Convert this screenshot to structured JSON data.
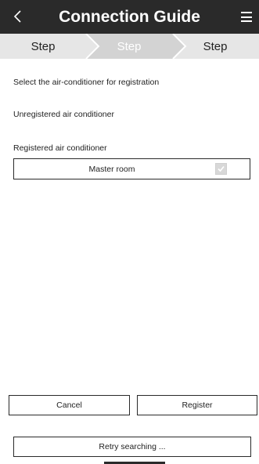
{
  "header": {
    "title": "Connection Guide",
    "back_icon": "chevron-left-icon",
    "menu_icon": "hamburger-menu-icon"
  },
  "steps": [
    {
      "label": "Step",
      "active": false
    },
    {
      "label": "Step",
      "active": true
    },
    {
      "label": "Step",
      "active": false
    }
  ],
  "content": {
    "instruction": "Select the air-conditioner for registration",
    "unregistered_label": "Unregistered air conditioner",
    "registered_label": "Registered air conditioner",
    "registered_items": [
      {
        "name": "Master room",
        "checked": true
      }
    ]
  },
  "buttons": {
    "cancel": "Cancel",
    "register": "Register",
    "retry": "Retry searching ..."
  },
  "colors": {
    "header_bg": "#2a2a2a",
    "step_active": "#d3d3d3",
    "step_inactive": "#e6e6e6"
  }
}
